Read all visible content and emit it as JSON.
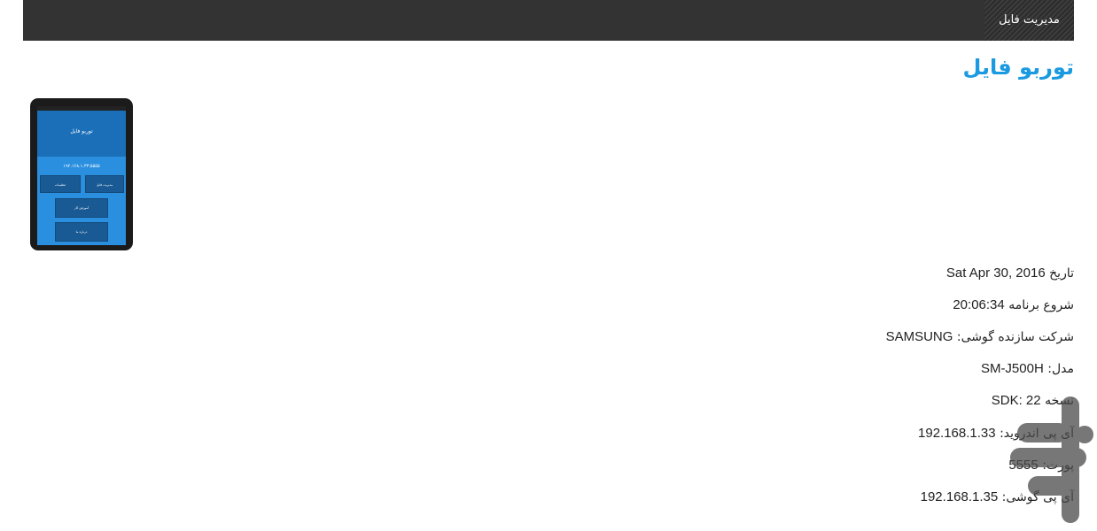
{
  "nav": {
    "tab_label": "مدیریت فایل"
  },
  "page_title": "توربو فایل",
  "phone_preview": {
    "app_title": "توربو فایل",
    "ip_text": "۱۹۲.۱۶۸.۱.۳۳:۵۵۵۵",
    "buttons": [
      "مدیریت فایل",
      "تنظیمات",
      "آموزش کار",
      "درباره ما"
    ]
  },
  "info": [
    {
      "label": "تاریخ",
      "value": "Sat Apr 30, 2016"
    },
    {
      "label": "شروع برنامه",
      "value": "20:06:34"
    },
    {
      "label": "شرکت سازنده گوشی:",
      "value": "SAMSUNG"
    },
    {
      "label": "مدل:",
      "value": "SM-J500H"
    },
    {
      "label": "نسخه",
      "value": "SDK: 22"
    },
    {
      "label": "آی پی اندروید:",
      "value": "192.168.1.33"
    },
    {
      "label": "پورت:",
      "value": "5555"
    },
    {
      "label": "آی پی گوشی:",
      "value": "192.168.1.35"
    }
  ],
  "colors": {
    "topbar": "#333333",
    "title": "#1a9ae0",
    "phone_screen": "#2b8fe0"
  }
}
